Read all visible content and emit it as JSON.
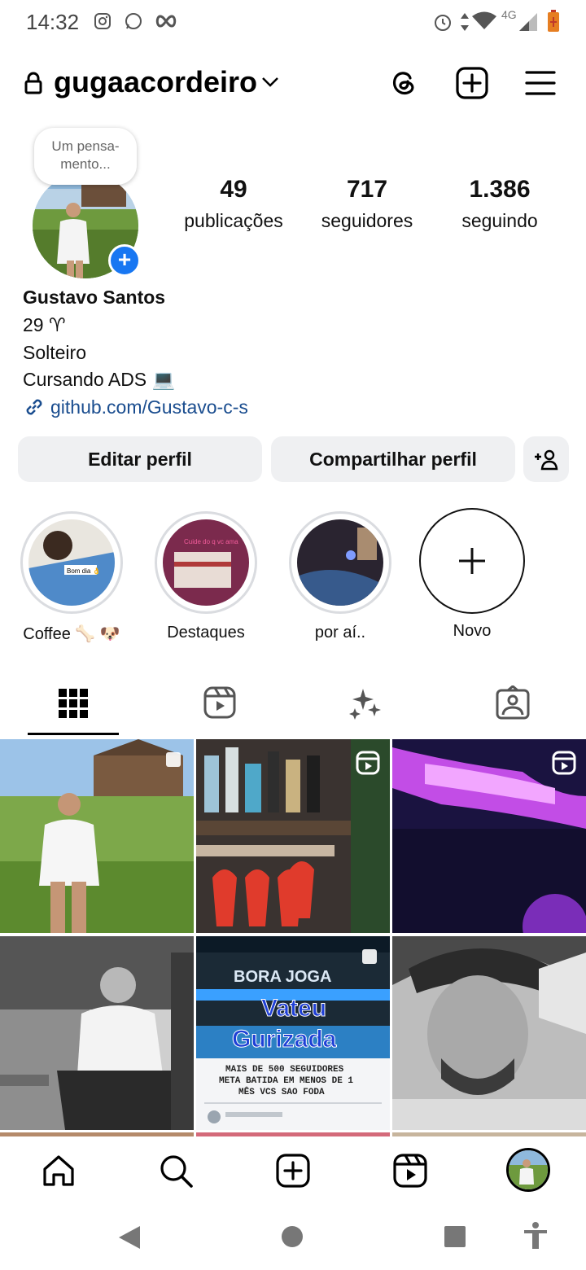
{
  "status_bar": {
    "time": "14:32",
    "network": "4G"
  },
  "header": {
    "username": "gugaacordeiro"
  },
  "note_bubble": {
    "text": "Um pensa-mento..."
  },
  "stats": [
    {
      "value": "49",
      "label": "publicações"
    },
    {
      "value": "717",
      "label": "seguidores"
    },
    {
      "value": "1.386",
      "label": "seguindo"
    }
  ],
  "bio": {
    "name": "Gustavo Santos",
    "line1": "29 ♈",
    "line2": "Solteiro",
    "line3": "Cursando ADS 💻",
    "link": "github.com/Gustavo-c-s"
  },
  "buttons": {
    "edit": "Editar perfil",
    "share": "Compartilhar perfil"
  },
  "highlights": [
    {
      "label": "Coffee 🦴 🐶",
      "sticker": "Bom dia 👌"
    },
    {
      "label": "Destaques",
      "sticker": "Cuide do q vc ama"
    },
    {
      "label": "por aí..",
      "sticker": ""
    },
    {
      "label": "Novo",
      "sticker": ""
    }
  ],
  "post_overlay": {
    "title": "BORA JOGA",
    "thanks1": "Vateu",
    "thanks2": "Gurizada",
    "line1": "MAIS DE 500 SEGUIDORES",
    "line2": "META BATIDA EM MENOS DE 1",
    "line3": "MÊS VCS SAO FODA"
  },
  "colors": {
    "link": "#1a4d8f",
    "accent": "#1877f2",
    "button_bg": "#eff0f2"
  }
}
